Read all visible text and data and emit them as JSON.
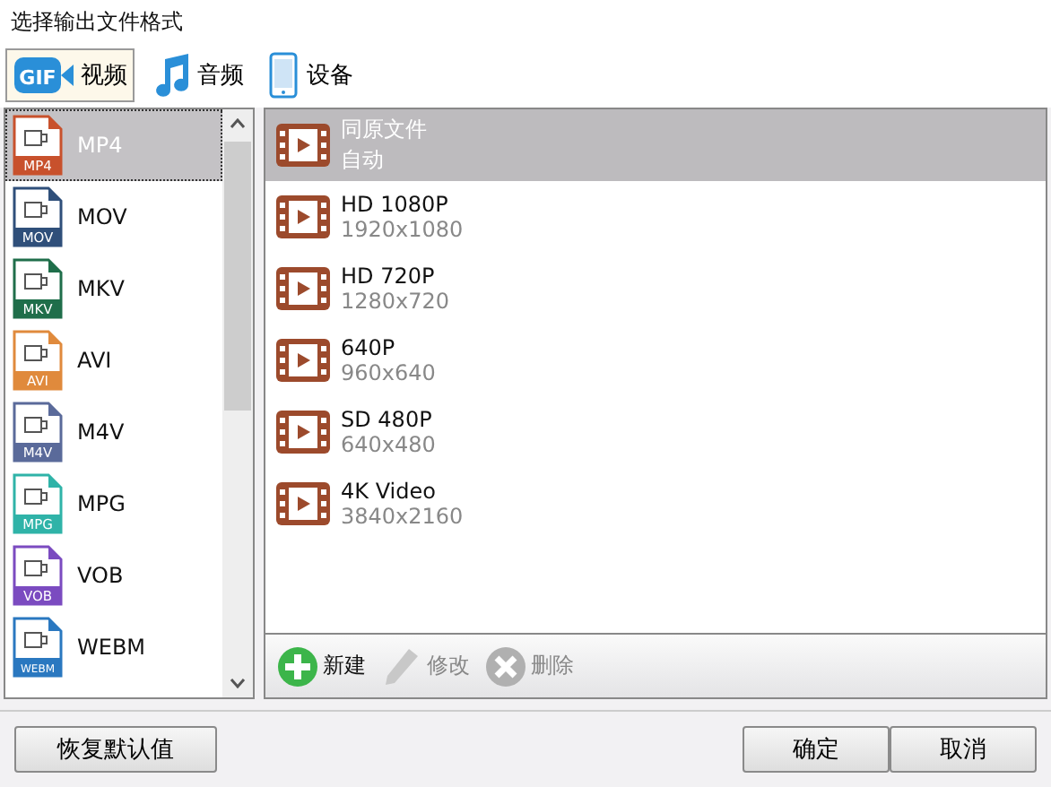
{
  "window": {
    "title": "选择输出文件格式"
  },
  "tabs": [
    {
      "label": "视频",
      "kind": "video",
      "badge": "GIF",
      "selected": true
    },
    {
      "label": "音频",
      "kind": "audio",
      "selected": false
    },
    {
      "label": "设备",
      "kind": "device",
      "selected": false
    }
  ],
  "formats": [
    {
      "label": "MP4",
      "badge": "MP4",
      "color": "#c8512c",
      "selected": true
    },
    {
      "label": "MOV",
      "badge": "MOV",
      "color": "#2f4f7a",
      "selected": false
    },
    {
      "label": "MKV",
      "badge": "MKV",
      "color": "#1f6e4a",
      "selected": false
    },
    {
      "label": "AVI",
      "badge": "AVI",
      "color": "#e08a3c",
      "selected": false
    },
    {
      "label": "M4V",
      "badge": "M4V",
      "color": "#5a6a9a",
      "selected": false
    },
    {
      "label": "MPG",
      "badge": "MPG",
      "color": "#2fb3a8",
      "selected": false
    },
    {
      "label": "VOB",
      "badge": "VOB",
      "color": "#7b4bc0",
      "selected": false
    },
    {
      "label": "WEBM",
      "badge": "WEBM",
      "color": "#2a78c0",
      "selected": false
    }
  ],
  "presets": [
    {
      "name": "同原文件",
      "detail": "自动",
      "selected": true
    },
    {
      "name": "HD 1080P",
      "detail": "1920x1080",
      "selected": false
    },
    {
      "name": "HD 720P",
      "detail": "1280x720",
      "selected": false
    },
    {
      "name": "640P",
      "detail": "960x640",
      "selected": false
    },
    {
      "name": "SD 480P",
      "detail": "640x480",
      "selected": false
    },
    {
      "name": "4K Video",
      "detail": "3840x2160",
      "selected": false
    }
  ],
  "toolbar": [
    {
      "label": "新建",
      "kind": "add",
      "disabled": false
    },
    {
      "label": "修改",
      "kind": "edit",
      "disabled": true
    },
    {
      "label": "删除",
      "kind": "delete",
      "disabled": true
    }
  ],
  "footer": {
    "reset": "恢复默认值",
    "ok": "确定",
    "cancel": "取消"
  }
}
